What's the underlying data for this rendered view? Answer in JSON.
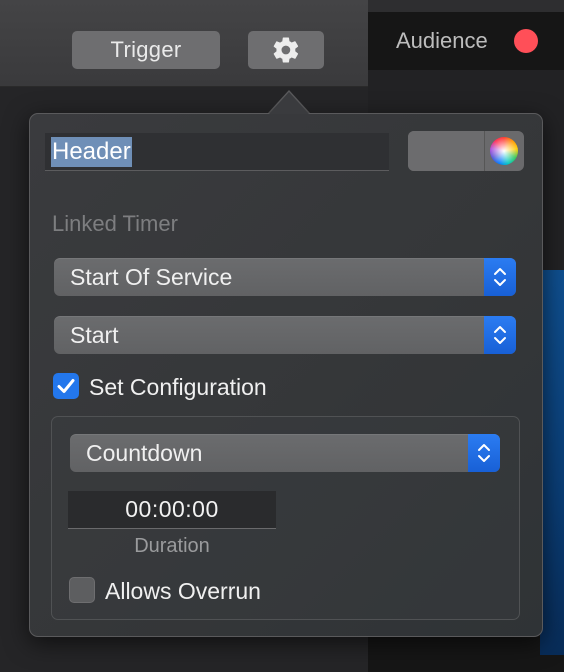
{
  "toolbar": {
    "trigger_label": "Trigger",
    "settings_icon": "gear-icon"
  },
  "audience": {
    "label": "Audience",
    "status_color": "#ff4f58"
  },
  "popover": {
    "header_field": {
      "value": "Header",
      "selected": true
    },
    "color_well": {
      "icon": "color-wheel-icon"
    },
    "linked_timer_label": "Linked Timer",
    "timer_select": {
      "value": "Start Of Service"
    },
    "action_select": {
      "value": "Start"
    },
    "set_configuration": {
      "label": "Set Configuration",
      "checked": true
    },
    "configuration": {
      "mode_select": {
        "value": "Countdown"
      },
      "duration": {
        "value": "00:00:00",
        "label": "Duration"
      },
      "allows_overrun": {
        "label": "Allows Overrun",
        "checked": false
      }
    }
  },
  "colors": {
    "accent": "#2377ec",
    "popover_bg": "#37383b",
    "selection": "#6f8fb7"
  }
}
